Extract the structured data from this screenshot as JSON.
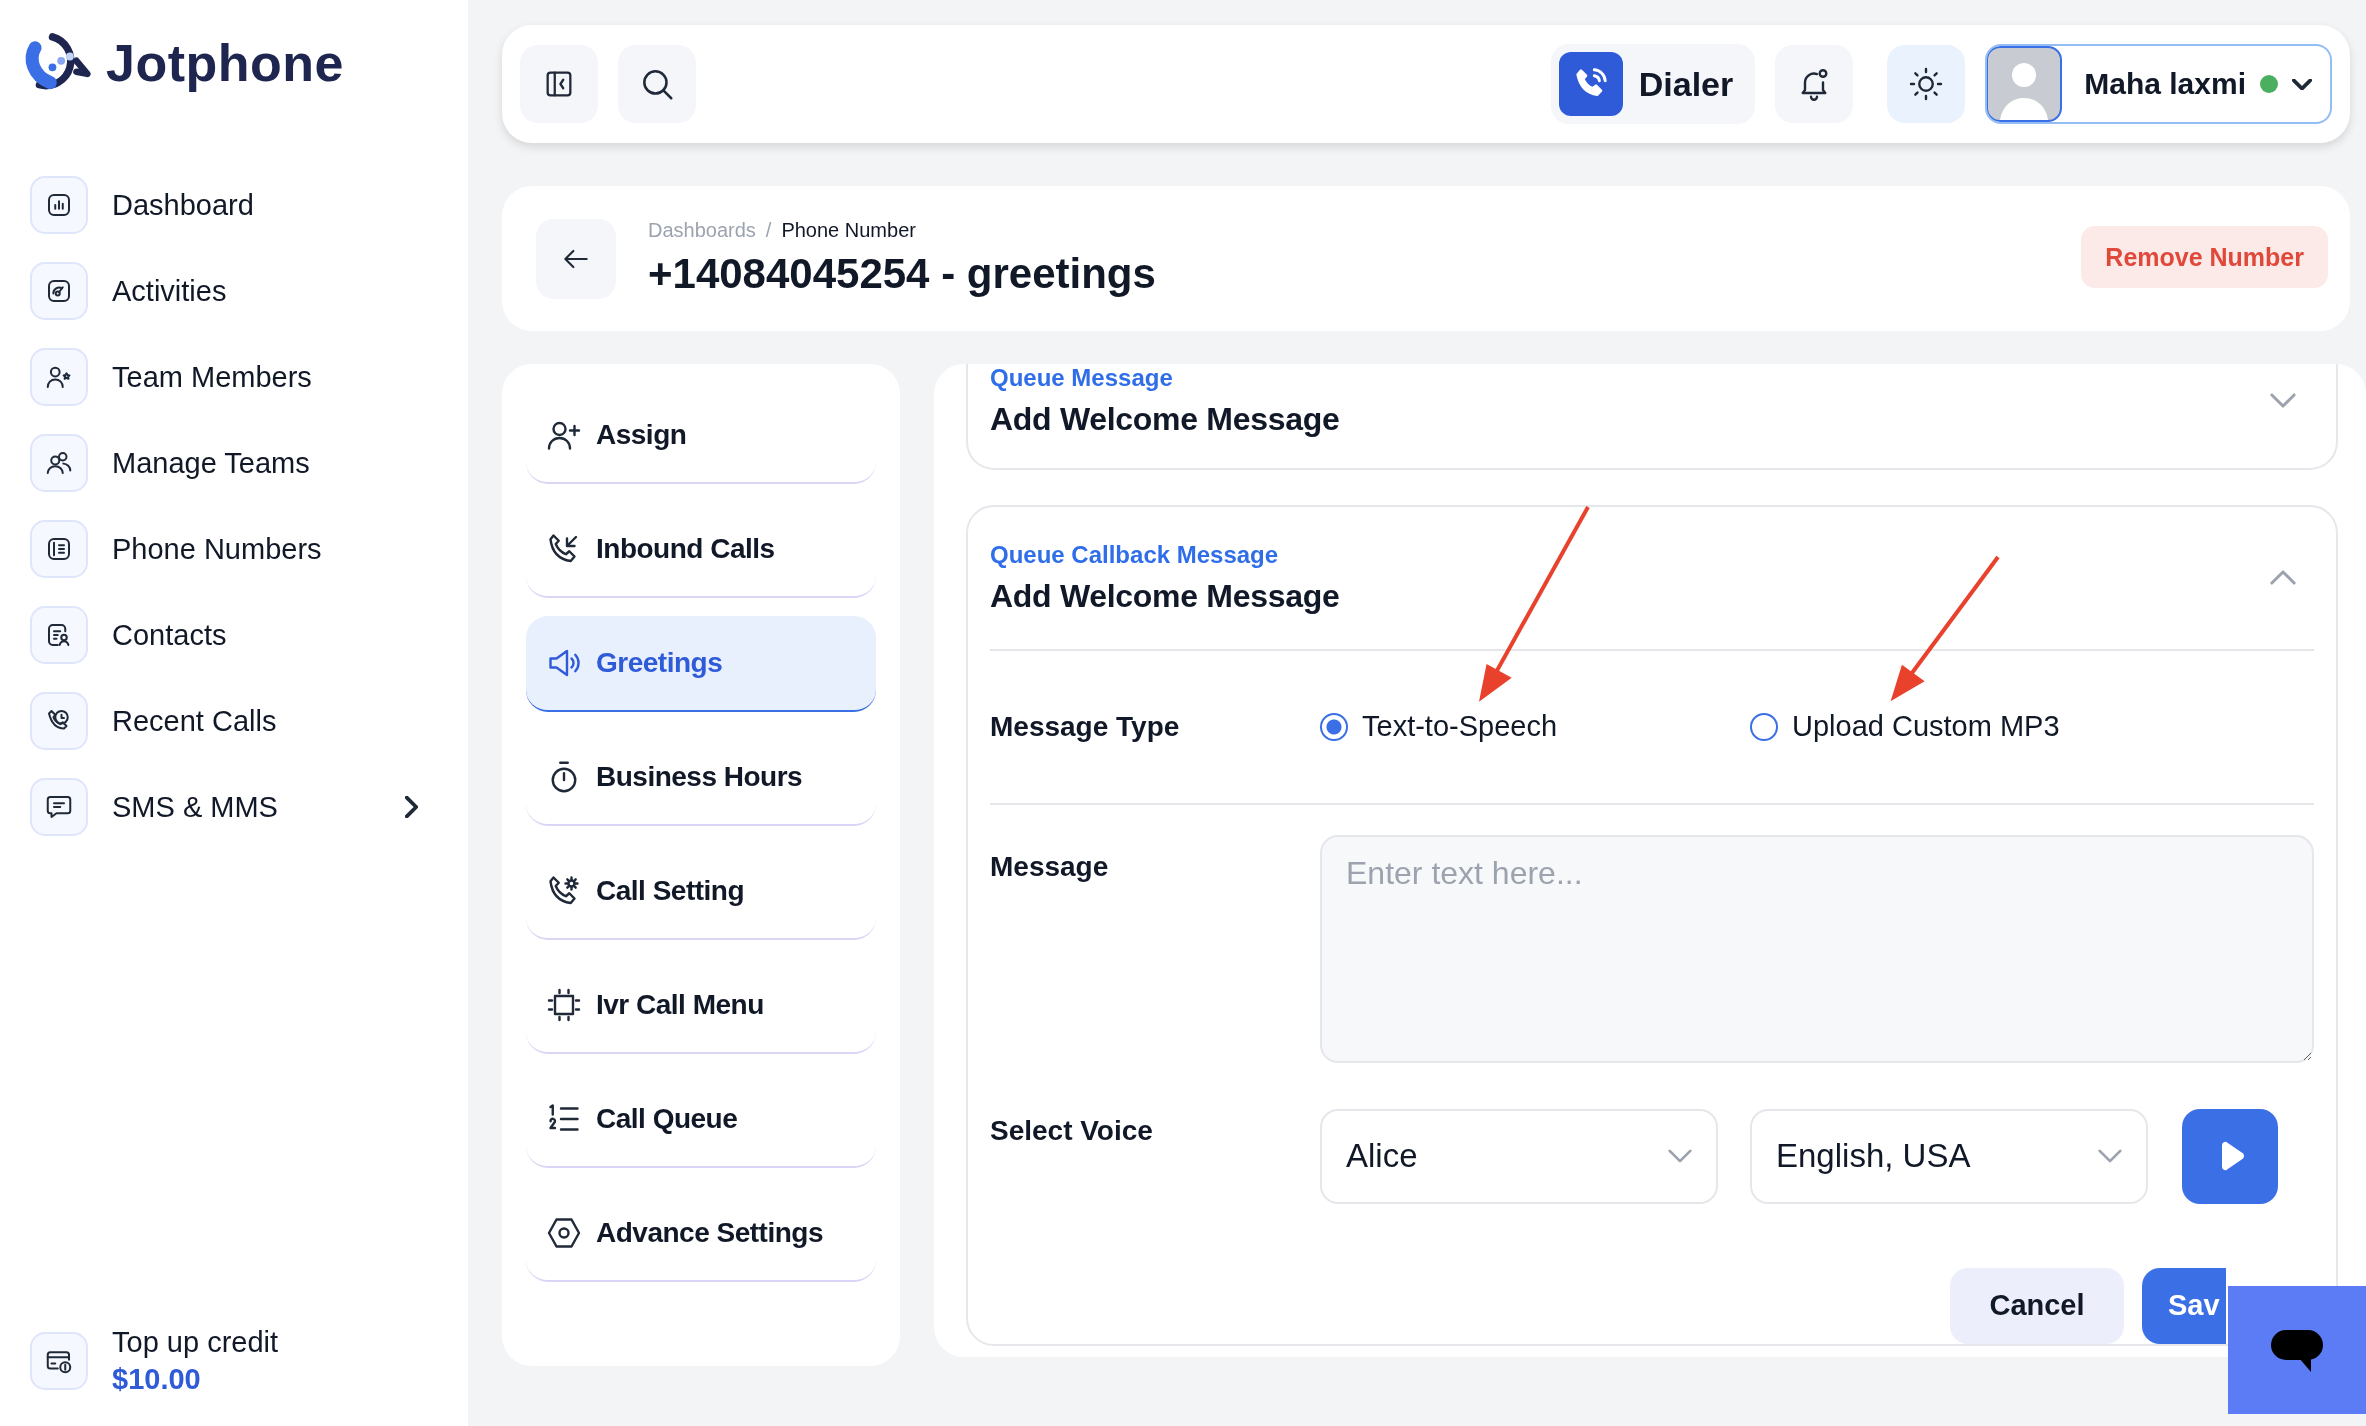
{
  "brand": {
    "name": "Jotphone"
  },
  "sidebar": {
    "items": [
      {
        "label": "Dashboard",
        "has_submenu": false
      },
      {
        "label": "Activities",
        "has_submenu": false
      },
      {
        "label": "Team Members",
        "has_submenu": false
      },
      {
        "label": "Manage Teams",
        "has_submenu": false
      },
      {
        "label": "Phone Numbers",
        "has_submenu": false
      },
      {
        "label": "Contacts",
        "has_submenu": false
      },
      {
        "label": "Recent Calls",
        "has_submenu": false
      },
      {
        "label": "SMS & MMS",
        "has_submenu": true
      }
    ]
  },
  "credit": {
    "label": "Top up credit",
    "amount": "$10.00"
  },
  "topbar": {
    "dialer": "Dialer",
    "user": {
      "name": "Maha laxmi",
      "online": true
    }
  },
  "page": {
    "breadcrumb": [
      "Dashboards",
      "Phone Number"
    ],
    "breadcrumb_separator": "/",
    "title": "+14084045254 - greetings",
    "remove_button": "Remove Number"
  },
  "settings_menu": [
    {
      "label": "Assign",
      "selected": false
    },
    {
      "label": "Inbound Calls",
      "selected": false
    },
    {
      "label": "Greetings",
      "selected": true
    },
    {
      "label": "Business Hours",
      "selected": false
    },
    {
      "label": "Call Setting",
      "selected": false
    },
    {
      "label": "Ivr Call Menu",
      "selected": false
    },
    {
      "label": "Call Queue",
      "selected": false
    },
    {
      "label": "Advance Settings",
      "selected": false
    }
  ],
  "sections": [
    {
      "caption": "Queue Message",
      "title": "Add Welcome Message",
      "expanded": false
    },
    {
      "caption": "Queue Callback Message",
      "title": "Add Welcome Message",
      "expanded": true,
      "message_type": {
        "label": "Message Type",
        "options": [
          {
            "label": "Text-to-Speech",
            "selected": true
          },
          {
            "label": "Upload Custom MP3",
            "selected": false
          }
        ]
      },
      "message": {
        "label": "Message",
        "placeholder": "Enter text here..."
      },
      "voice": {
        "label": "Select Voice",
        "voice": "Alice",
        "language": "English, USA"
      },
      "buttons": {
        "cancel": "Cancel",
        "save": "Sav"
      }
    }
  ]
}
